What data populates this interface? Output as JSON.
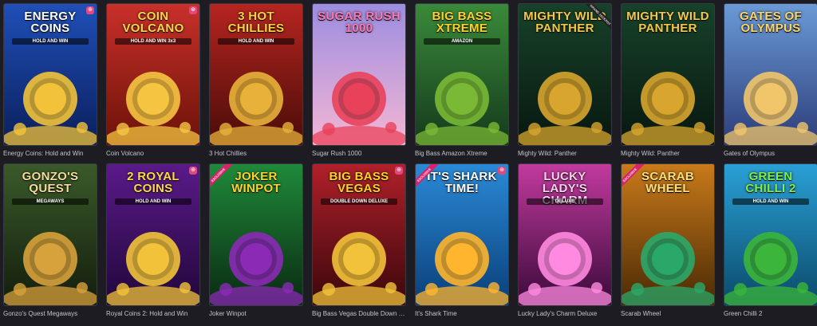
{
  "games": [
    {
      "name": "Energy Coins: Hold and Win",
      "art_title": "ENERGY COINS",
      "art_sub": "HOLD AND WIN",
      "bg": "#1f4fb8",
      "bg2": "#0b1f5c",
      "accent": "#f2c33a",
      "title_color": "#ffffff",
      "badge": "⊕"
    },
    {
      "name": "Coin Volcano",
      "art_title": "COIN VOLCANO",
      "art_sub": "HOLD AND WIN 3x3",
      "bg": "#c9302a",
      "bg2": "#6b1208",
      "accent": "#f5c542",
      "title_color": "#ffd84a",
      "badge": "⊕"
    },
    {
      "name": "3 Hot Chillies",
      "art_title": "3 HOT CHILLIES",
      "art_sub": "HOLD AND WIN",
      "bg": "#b62520",
      "bg2": "#4a0c08",
      "accent": "#e8b23a",
      "title_color": "#ffd23d",
      "badge": ""
    },
    {
      "name": "Sugar Rush 1000",
      "art_title": "Sugar Rush 1000",
      "art_sub": "",
      "bg": "#9d8de0",
      "bg2": "#f3b6d4",
      "accent": "#e9415a",
      "title_color": "#ff7ab5",
      "badge": ""
    },
    {
      "name": "Big Bass Amazon Xtreme",
      "art_title": "BIG BASS XTREME",
      "art_sub": "AMAZON",
      "bg": "#3a8a3a",
      "bg2": "#153a1c",
      "accent": "#79b935",
      "title_color": "#ffd22e",
      "badge": ""
    },
    {
      "name": "Mighty Wild: Panther",
      "art_title": "MIGHTY WILD PANTHER",
      "art_sub": "",
      "bg": "#17422a",
      "bg2": "#08170f",
      "accent": "#d8a52e",
      "title_color": "#f5c84a",
      "badge": "",
      "corner": "GRAND JACKPOT"
    },
    {
      "name": "Mighty Wild: Panther",
      "art_title": "MIGHTY WILD PANTHER",
      "art_sub": "",
      "bg": "#17422a",
      "bg2": "#08170f",
      "accent": "#d8a52e",
      "title_color": "#f5c84a",
      "badge": ""
    },
    {
      "name": "Gates of Olympus",
      "art_title": "GATES OF OLYMPUS",
      "art_sub": "",
      "bg": "#6a9ad6",
      "bg2": "#2c3d7a",
      "accent": "#f1c56a",
      "title_color": "#ffd66a",
      "badge": ""
    },
    {
      "name": "Gonzo's Quest Megaways",
      "art_title": "GONZO'S QUEST",
      "art_sub": "MEGAWAYS",
      "bg": "#3a5a2a",
      "bg2": "#141d0d",
      "accent": "#d7a23b",
      "title_color": "#f6dc9a",
      "badge": ""
    },
    {
      "name": "Royal Coins 2: Hold and Win",
      "art_title": "2 ROYAL COINS",
      "art_sub": "HOLD AND WIN",
      "bg": "#5a1a8a",
      "bg2": "#21073a",
      "accent": "#f2c33a",
      "title_color": "#ffd84a",
      "badge": "⊕"
    },
    {
      "name": "Joker Winpot",
      "art_title": "JOKER WINPOT",
      "art_sub": "",
      "bg": "#1f8a3a",
      "bg2": "#0a2a12",
      "accent": "#8a2ab5",
      "title_color": "#ffd22e",
      "badge": "",
      "corner": "EXCLUSIVE"
    },
    {
      "name": "Big Bass Vegas Double Down Deluxe",
      "art_title": "BIG BASS VEGAS",
      "art_sub": "DOUBLE DOWN DELUXE",
      "bg": "#b0202a",
      "bg2": "#3a070b",
      "accent": "#f2c33a",
      "title_color": "#ffd22e",
      "badge": "⊕"
    },
    {
      "name": "It's Shark Time",
      "art_title": "IT'S SHARK TIME!",
      "art_sub": "",
      "bg": "#2a8ad6",
      "bg2": "#0a3f7a",
      "accent": "#ffb52e",
      "title_color": "#ffffff",
      "badge": "⊕",
      "corner": "EXCLUSIVE"
    },
    {
      "name": "Lucky Lady's Charm Deluxe",
      "art_title": "Lucky Lady's Charm",
      "art_sub": "DELUXE",
      "bg": "#c23a9e",
      "bg2": "#3a0a3a",
      "accent": "#ff8ae0",
      "title_color": "#ffd0f0",
      "badge": ""
    },
    {
      "name": "Scarab Wheel",
      "art_title": "SCARAB WHEEL",
      "art_sub": "",
      "bg": "#c97a1a",
      "bg2": "#4a2a05",
      "accent": "#2aa86a",
      "title_color": "#ffe07a",
      "badge": "",
      "corner": "EXCLUSIVE"
    },
    {
      "name": "Green Chilli 2",
      "art_title": "GREEN CHILLI 2",
      "art_sub": "HOLD AND WIN",
      "bg": "#2aa0d6",
      "bg2": "#0b4a6a",
      "accent": "#3bb53a",
      "title_color": "#7ef04a",
      "badge": ""
    }
  ]
}
